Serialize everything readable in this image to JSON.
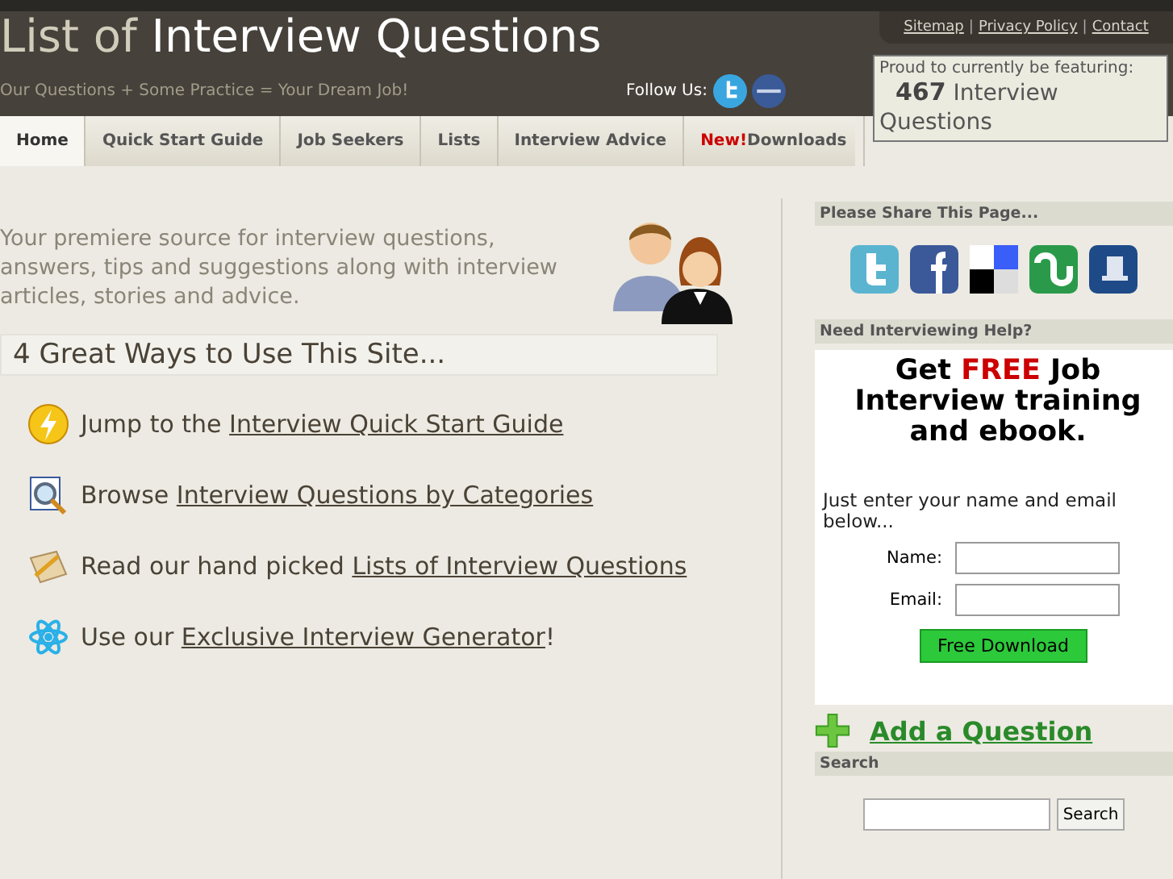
{
  "header": {
    "title_prefix": "List of",
    "title_main": "Interview Questions",
    "tagline": "Our Questions + Some Practice = Your Dream Job!",
    "follow_label": "Follow Us:",
    "follow_icons": [
      {
        "kind": "twitter"
      },
      {
        "kind": "facebook"
      }
    ],
    "top_links": [
      "Sitemap",
      "Privacy Policy",
      "Contact"
    ],
    "link_separator": "|",
    "featuring": {
      "label": "Proud to currently be featuring:",
      "count": "467",
      "text": "Interview Questions"
    }
  },
  "nav": [
    {
      "label": "Home",
      "selected": true
    },
    {
      "label": "Quick Start Guide",
      "selected": false
    },
    {
      "label": "Job Seekers",
      "selected": false
    },
    {
      "label": "Lists",
      "selected": false
    },
    {
      "label": "Interview Advice",
      "selected": false
    },
    {
      "badge": "New!",
      "label": "Downloads",
      "selected": false
    }
  ],
  "intro": "Your premiere source for interview questions, answers, tips and suggestions along with interview articles, stories and advice.",
  "ways_heading": "4 Great Ways to Use This Site...",
  "ways": [
    {
      "kind": "bolt",
      "text": "Jump to the",
      "link": "Interview Quick Start Guide"
    },
    {
      "kind": "magnifier",
      "text": "Browse",
      "link": "Interview Questions by Categories"
    },
    {
      "kind": "notepad",
      "text": "Read our hand picked",
      "link": "Lists of Interview Questions"
    },
    {
      "kind": "atom",
      "text": "Use our",
      "link": "Exclusive Interview Generator",
      "after": "!"
    }
  ],
  "sidebar": {
    "share_heading": "Please Share This Page...",
    "share_icons": [
      {
        "kind": "twitter"
      },
      {
        "kind": "facebook"
      },
      {
        "kind": "delicious"
      },
      {
        "kind": "stumbleupon"
      },
      {
        "kind": "digg"
      }
    ],
    "help_heading": "Need Interviewing Help?",
    "promo": {
      "before": "Get",
      "highlight": "FREE",
      "after": "Job Interview training and ebook.",
      "instructions": "Just enter your name and email below...",
      "fields": [
        {
          "label": "Name:"
        },
        {
          "label": "Email:"
        }
      ],
      "button": "Free Download"
    },
    "add_question": "Add a Question",
    "search_heading": "Search",
    "search_button": "Search"
  }
}
